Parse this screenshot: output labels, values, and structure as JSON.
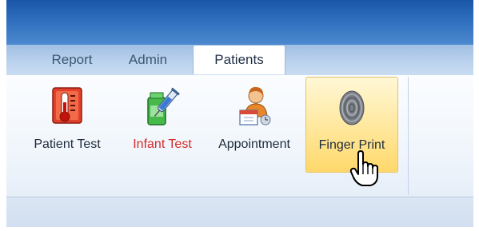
{
  "tabs": {
    "report": "Report",
    "admin": "Admin",
    "patients": "Patients"
  },
  "ribbon": {
    "patient_test": {
      "label": "Patient Test",
      "icon": "thermometer-icon"
    },
    "infant_test": {
      "label": "Infant Test",
      "icon": "syringe-bottle-icon",
      "color": "#d42b2b"
    },
    "appointment": {
      "label": "Appointment",
      "icon": "person-calendar-icon"
    },
    "finger_print": {
      "label": "Finger Print",
      "icon": "fingerprint-icon",
      "state": "hover"
    }
  },
  "colors": {
    "title_blue": "#2f6fbe",
    "hover_gold": "#ffe79b",
    "infant_red": "#d42b2b"
  }
}
